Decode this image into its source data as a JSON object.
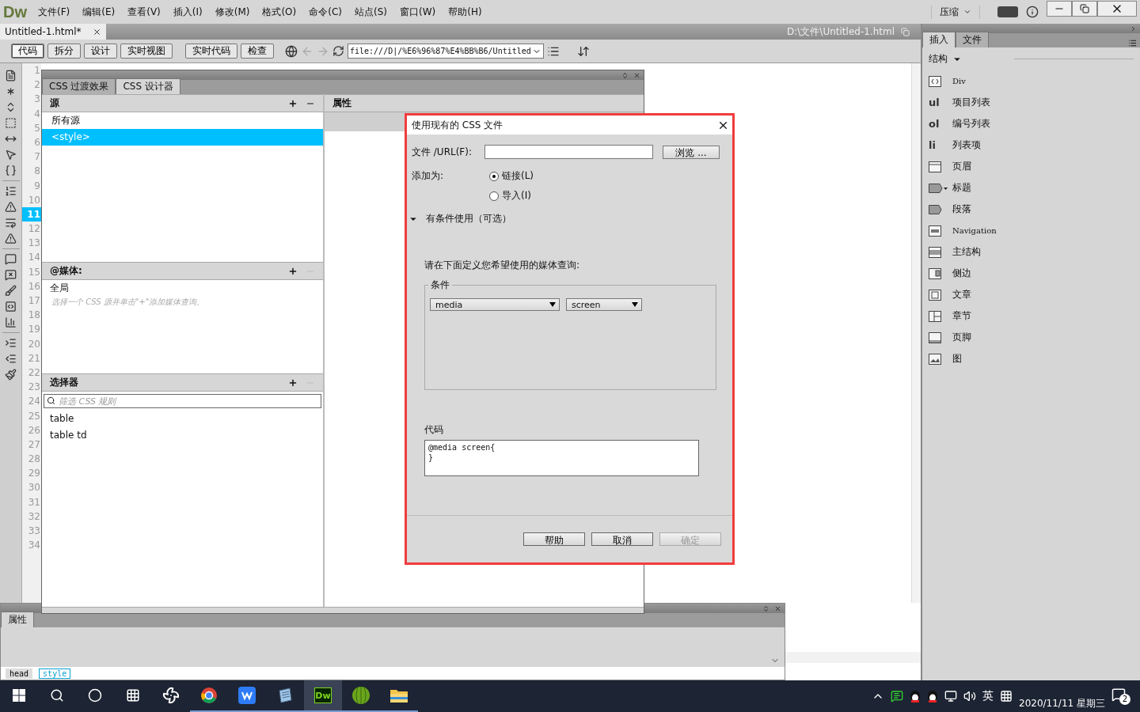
{
  "app": {
    "logo": "Dw",
    "menu": [
      "文件(F)",
      "编辑(E)",
      "查看(V)",
      "插入(I)",
      "修改(M)",
      "格式(O)",
      "命令(C)",
      "站点(S)",
      "窗口(W)",
      "帮助(H)"
    ],
    "workspace": "压缩"
  },
  "document": {
    "tab": "Untitled-1.html*",
    "path": "D:\\文件\\Untitled-1.html"
  },
  "toolbar": {
    "views": [
      {
        "label": "代码",
        "selected": true
      },
      {
        "label": "拆分",
        "selected": false
      },
      {
        "label": "设计",
        "selected": false
      },
      {
        "label": "实时视图",
        "selected": false
      }
    ],
    "buttons": [
      "实时代码",
      "检查"
    ],
    "address": "file:///D|/%E6%96%87%E4%BB%B6/Untitled"
  },
  "line_numbers": [
    {
      "label": "1",
      "selected": false
    },
    {
      "label": "2",
      "selected": false
    },
    {
      "label": "3",
      "selected": false
    },
    {
      "label": "4",
      "selected": false
    },
    {
      "label": "5",
      "selected": false
    },
    {
      "label": "6",
      "selected": false
    },
    {
      "label": "7",
      "selected": false
    },
    {
      "label": "8",
      "selected": false
    },
    {
      "label": "9",
      "selected": false
    },
    {
      "label": "10",
      "selected": false
    },
    {
      "label": "11",
      "selected": true
    },
    {
      "label": "12",
      "selected": false
    },
    {
      "label": "13",
      "selected": false
    },
    {
      "label": "14",
      "selected": false
    },
    {
      "label": "15",
      "selected": false
    },
    {
      "label": "16",
      "selected": false
    },
    {
      "label": "17",
      "selected": false
    },
    {
      "label": "18",
      "selected": false
    },
    {
      "label": "19",
      "selected": false
    },
    {
      "label": "20",
      "selected": false
    },
    {
      "label": "21",
      "selected": false
    },
    {
      "label": "22",
      "selected": false
    },
    {
      "label": "23",
      "selected": false
    },
    {
      "label": "24",
      "selected": false
    },
    {
      "label": "25",
      "selected": false
    },
    {
      "label": "26",
      "selected": false
    },
    {
      "label": "27",
      "selected": false
    },
    {
      "label": "28",
      "selected": false
    },
    {
      "label": "29",
      "selected": false
    },
    {
      "label": "30",
      "selected": false
    },
    {
      "label": "31",
      "selected": false
    },
    {
      "label": "32",
      "selected": false
    },
    {
      "label": "33",
      "selected": false
    },
    {
      "label": "34",
      "selected": false
    }
  ],
  "css_panel": {
    "tabs": [
      {
        "label": "CSS 过渡效果",
        "selected": false
      },
      {
        "label": "CSS 设计器",
        "selected": true
      }
    ],
    "sources": {
      "title": "源",
      "items": [
        {
          "label": "所有源",
          "selected": false
        },
        {
          "label": "<style>",
          "selected": true
        }
      ]
    },
    "media": {
      "title": "@媒体:",
      "items": [
        "全局"
      ],
      "hint": "选择一个 CSS 源并单击\"+\"添加媒体查询。"
    },
    "selectors": {
      "title": "选择器",
      "placeholder": "筛选 CSS 规则",
      "items": [
        "table",
        "table td"
      ]
    },
    "properties": {
      "title": "属性"
    }
  },
  "dialog": {
    "title": "使用现有的 CSS 文件",
    "file_label": "文件 /URL(F):",
    "browse": "浏览 ...",
    "add_as_label": "添加为:",
    "add_as": [
      {
        "label": "链接(L)",
        "selected": true
      },
      {
        "label": "导入(I)",
        "selected": false
      }
    ],
    "conditional": {
      "label": "有条件使用（可选）",
      "expanded": true
    },
    "prompt": "请在下面定义您希望使用的媒体查询:",
    "group": "条件",
    "selects": [
      "media",
      "screen"
    ],
    "code_label": "代码",
    "code": [
      "@media screen{",
      "}"
    ],
    "buttons": [
      {
        "label": "帮助",
        "disabled": false
      },
      {
        "label": "取消",
        "disabled": false
      },
      {
        "label": "确定",
        "disabled": true
      }
    ]
  },
  "insert_panel": {
    "tabs": [
      {
        "label": "插入",
        "selected": true
      },
      {
        "label": "文件",
        "selected": false
      }
    ],
    "category": "结构",
    "items": [
      {
        "kind": "div",
        "label": "Div"
      },
      {
        "kind": "glyph",
        "glyph": "ul",
        "label": "项目列表"
      },
      {
        "kind": "glyph",
        "glyph": "ol",
        "label": "编号列表"
      },
      {
        "kind": "glyph",
        "glyph": "li",
        "label": "列表项"
      },
      {
        "kind": "header",
        "label": "页眉"
      },
      {
        "kind": "heading",
        "label": "标题"
      },
      {
        "kind": "paragraph",
        "label": "段落"
      },
      {
        "kind": "nav",
        "label": "Navigation"
      },
      {
        "kind": "main",
        "label": "主结构"
      },
      {
        "kind": "aside",
        "label": "侧边"
      },
      {
        "kind": "article",
        "label": "文章"
      },
      {
        "kind": "section",
        "label": "章节"
      },
      {
        "kind": "footer",
        "label": "页脚"
      },
      {
        "kind": "figure",
        "label": "图"
      }
    ]
  },
  "properties_panel": {
    "title": "属性"
  },
  "tag_selector": [
    {
      "label": "head",
      "selected": false
    },
    {
      "label": "style",
      "selected": true
    }
  ],
  "taskbar": {
    "apps": [
      {
        "kind": "pinwheel",
        "running": false,
        "selected": false
      },
      {
        "kind": "browser",
        "running": true,
        "selected": false
      },
      {
        "kind": "writer",
        "running": true,
        "selected": false
      },
      {
        "kind": "notepad",
        "running": true,
        "selected": false
      },
      {
        "kind": "dw",
        "label": "Dw",
        "running": true,
        "selected": true
      },
      {
        "kind": "ball",
        "running": true,
        "selected": false
      },
      {
        "kind": "folder",
        "running": true,
        "selected": false
      }
    ],
    "ime": "英",
    "date": "2020/11/11 星期三",
    "notifications": "2"
  }
}
